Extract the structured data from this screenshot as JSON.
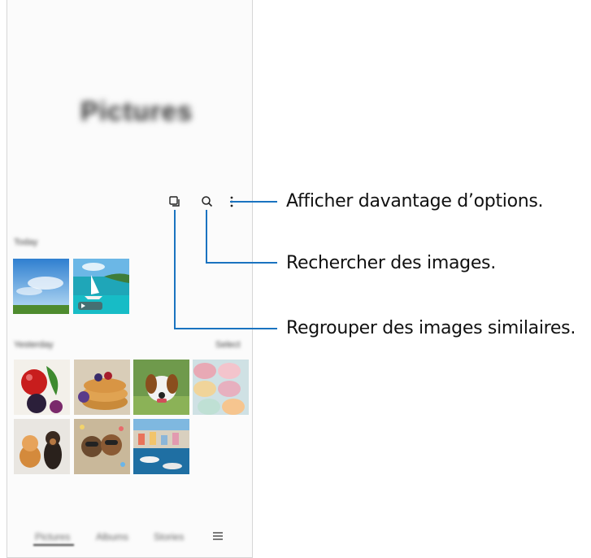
{
  "app": {
    "header_title": "Pictures",
    "sections": [
      {
        "label": "Today",
        "action": ""
      },
      {
        "label": "Yesterday",
        "action": "Select"
      }
    ],
    "toolbar": {
      "group_icon": "group-similar-icon",
      "search_icon": "search-icon",
      "more_icon": "more-options-icon"
    },
    "bottom_nav": {
      "items": [
        "Pictures",
        "Albums",
        "Stories"
      ],
      "active": "Pictures",
      "menu_icon": "hamburger-menu-icon"
    }
  },
  "callouts": {
    "more_options": "Afficher davantage d’options.",
    "search": "Rechercher des images.",
    "group_similar": "Regrouper des images similaires."
  },
  "colors": {
    "callout_line": "#1a73c0",
    "frame_border": "#d6d6d6"
  }
}
